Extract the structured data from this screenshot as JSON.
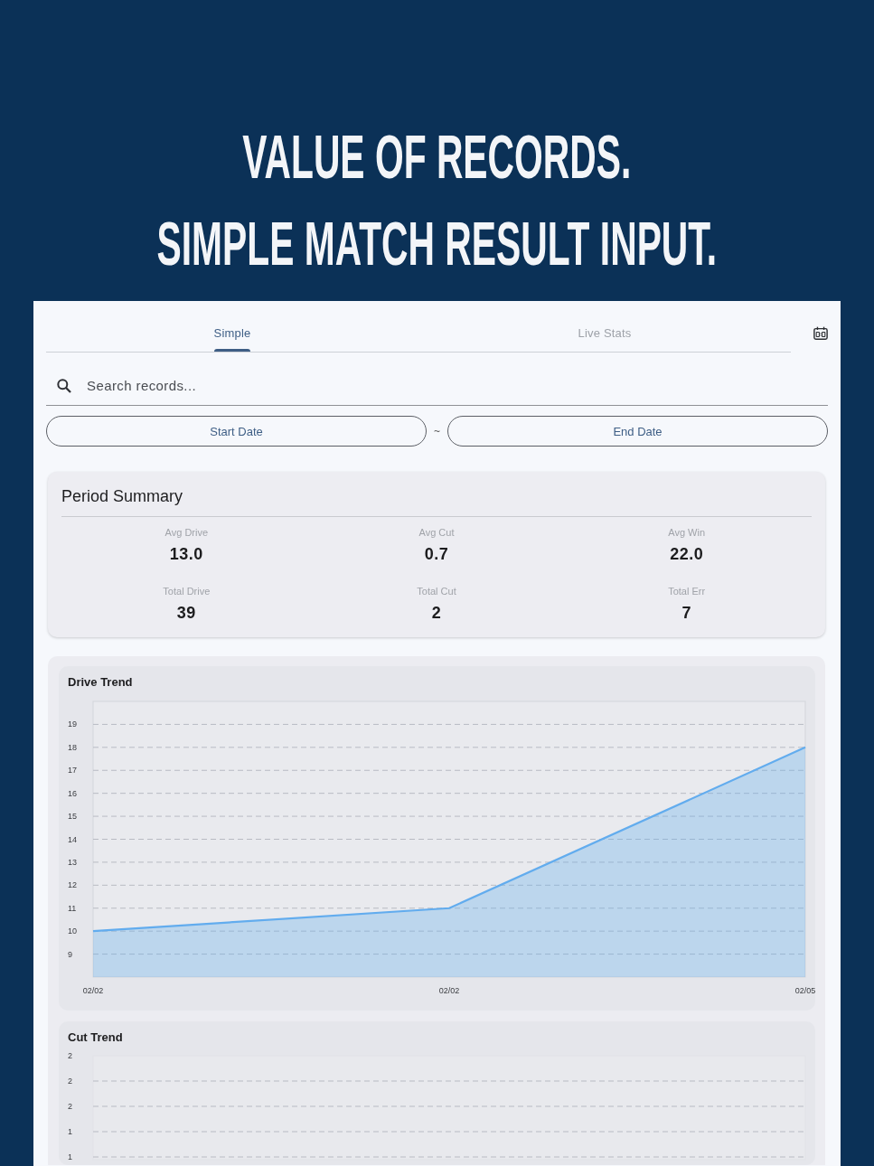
{
  "headline": {
    "lines": [
      "VALUE OF RECORDS.",
      "SIMPLE MATCH RESULT INPUT."
    ]
  },
  "tabs": [
    {
      "label": "Simple",
      "selected": true
    },
    {
      "label": "Live Stats",
      "selected": false
    }
  ],
  "search": {
    "placeholder": "Search records..."
  },
  "date_range": {
    "start_label": "Start Date",
    "separator": "~",
    "end_label": "End Date"
  },
  "period_summary": {
    "title": "Period Summary",
    "stats": [
      {
        "label": "Avg Drive",
        "value": "13.0"
      },
      {
        "label": "Avg Cut",
        "value": "0.7"
      },
      {
        "label": "Avg Win",
        "value": "22.0"
      },
      {
        "label": "Total Drive",
        "value": "39"
      },
      {
        "label": "Total Cut",
        "value": "2"
      },
      {
        "label": "Total Err",
        "value": "7"
      }
    ]
  },
  "charts": [
    {
      "title": "Drive Trend",
      "chart_data": {
        "type": "area",
        "categories": [
          "02/02",
          "02/02",
          "02/05"
        ],
        "series": [
          {
            "color": "#62acee",
            "values": [
              10,
              11,
              18
            ]
          }
        ],
        "ylim": [
          8,
          20
        ],
        "yticks": [
          9,
          10,
          11,
          12,
          13,
          14,
          15,
          16,
          17,
          18,
          19
        ],
        "grid": true
      }
    },
    {
      "title": "Cut Trend",
      "y_axis_labels": [
        "2",
        "2",
        "2",
        "1",
        "1"
      ]
    }
  ]
}
